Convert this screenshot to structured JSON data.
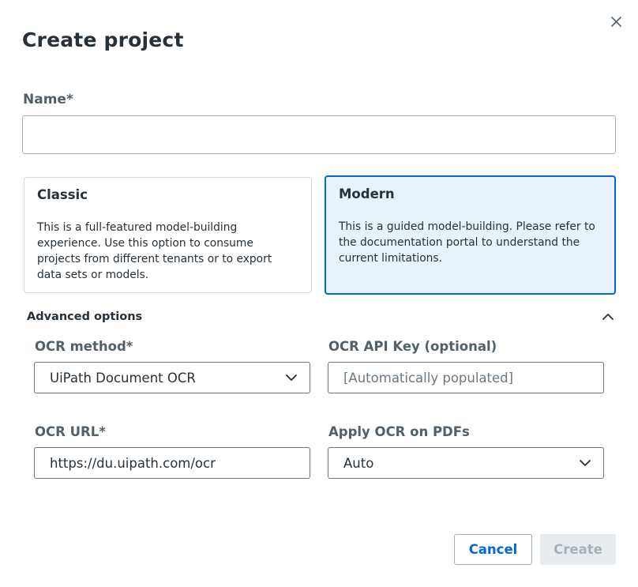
{
  "dialog": {
    "title": "Create project",
    "close_icon": "close-icon"
  },
  "name_field": {
    "label": "Name*",
    "value": "",
    "placeholder": ""
  },
  "project_types": [
    {
      "title": "Classic",
      "description": "This is a full-featured model-building experience. Use this option to consume projects from different tenants or to export data sets or models.",
      "selected": false
    },
    {
      "title": "Modern",
      "description": "This is a guided model-building. Please refer to the documentation portal to understand the current limitations.",
      "selected": true
    }
  ],
  "advanced": {
    "label": "Advanced options",
    "expanded": true,
    "toggle_icon": "chevron-up-icon",
    "ocr_method": {
      "label": "OCR method*",
      "value": "UiPath Document OCR"
    },
    "ocr_api_key": {
      "label": "OCR API Key (optional)",
      "value": "",
      "placeholder": "[Automatically populated]"
    },
    "ocr_url": {
      "label": "OCR URL*",
      "value": "https://du.uipath.com/ocr"
    },
    "apply_ocr_pdfs": {
      "label": "Apply OCR on PDFs",
      "value": "Auto"
    }
  },
  "footer": {
    "cancel_label": "Cancel",
    "create_label": "Create",
    "create_enabled": false
  },
  "colors": {
    "accent": "#0067df",
    "selected_card_bg": "#e9f1fa",
    "text": "#273139",
    "muted_label": "#526069",
    "disabled_bg": "#e9ecef",
    "disabled_text": "#a4b1b8"
  }
}
